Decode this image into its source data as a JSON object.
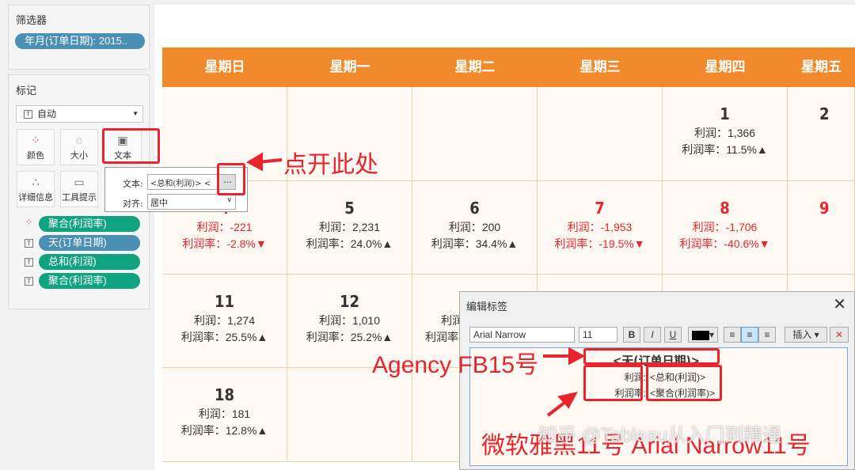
{
  "filters": {
    "title": "筛选器",
    "pill": "年月(订单日期): 2015.."
  },
  "marks": {
    "title": "标记",
    "type": "自动",
    "cards": [
      {
        "label": "颜色",
        "icon": "color-icon"
      },
      {
        "label": "大小",
        "icon": "size-icon"
      },
      {
        "label": "文本",
        "icon": "text-icon"
      },
      {
        "label": "详细信息",
        "icon": "detail-icon"
      },
      {
        "label": "工具提示",
        "icon": "tooltip-icon"
      }
    ],
    "fields": [
      {
        "label": "聚合(利润率)",
        "icon": "color-icon"
      },
      {
        "label": "天(订单日期)",
        "icon": "text-icon"
      },
      {
        "label": "总和(利润)",
        "icon": "text-icon"
      },
      {
        "label": "聚合(利润率)",
        "icon": "text-icon"
      }
    ]
  },
  "text_popup": {
    "text_label": "文本:",
    "text_value": "<总和(利润)> <",
    "more": "...",
    "align_label": "对齐:",
    "align_value": "居中"
  },
  "calendar": {
    "headers": [
      "星期日",
      "星期一",
      "星期二",
      "星期三",
      "星期四",
      "星期五"
    ],
    "profit_label": "利润：",
    "rate_label": "利润率：",
    "rows": [
      [
        null,
        null,
        null,
        null,
        {
          "day": "1",
          "profit": "1,366",
          "rate": "11.5%▲",
          "neg": false
        },
        {
          "day": "2",
          "neg": false
        }
      ],
      [
        {
          "day": "4",
          "profit": "-221",
          "rate": "-2.8%▼",
          "neg": true
        },
        {
          "day": "5",
          "profit": "2,231",
          "rate": "24.0%▲",
          "neg": false
        },
        {
          "day": "6",
          "profit": "200",
          "rate": "34.4%▲",
          "neg": false
        },
        {
          "day": "7",
          "profit": "-1,953",
          "rate": "-19.5%▼",
          "neg": true
        },
        {
          "day": "8",
          "profit": "-1,706",
          "rate": "-40.6%▼",
          "neg": true
        },
        {
          "day": "9",
          "neg": true
        }
      ],
      [
        {
          "day": "11",
          "profit": "1,274",
          "rate": "25.5%▲",
          "neg": false
        },
        {
          "day": "12",
          "profit": "1,010",
          "rate": "25.2%▲",
          "neg": false
        },
        {
          "labels_only": true
        },
        null,
        null,
        null
      ],
      [
        {
          "day": "18",
          "profit": "181",
          "rate": "12.8%▲",
          "neg": false
        },
        null,
        null,
        null,
        null,
        null
      ]
    ]
  },
  "dialog": {
    "title": "编辑标签",
    "font": "Arial Narrow",
    "size": "11",
    "bold": "B",
    "italic": "I",
    "underline": "U",
    "insert": "插入 ▾",
    "line1": "<天(订单日期)>",
    "label1": "利润:",
    "field1": "<总和(利润)>",
    "label2": "利润率:",
    "field2": "<聚合(利润率)>"
  },
  "annotations": {
    "click_here": "点开此处",
    "agency": "Agency FB15号",
    "fonts": "微软雅黑11号  Arial Narrow11号"
  },
  "watermark": "知乎 @Tableau从入门到精通",
  "colors": {
    "header": "#f08a2c",
    "negative": "#e8242c",
    "pill_green": "#10a37f",
    "pill_blue": "#4b8fb5"
  }
}
